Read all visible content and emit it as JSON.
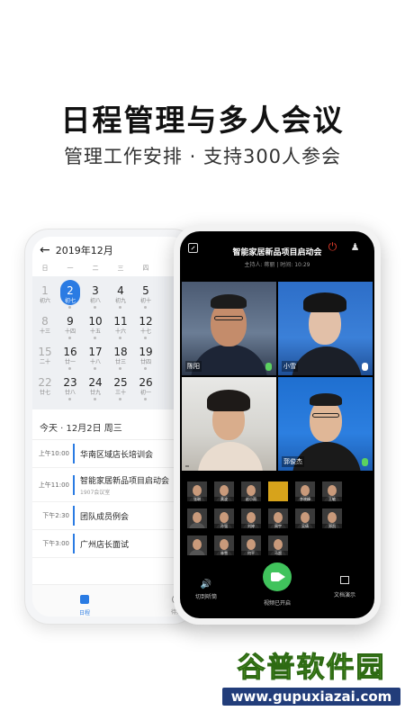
{
  "headline": "日程管理与多人会议",
  "subheadline": "管理工作安排 · 支持300人参会",
  "calendar": {
    "month_label": "2019年12月",
    "weekdays": [
      "日",
      "一",
      "二",
      "三",
      "四"
    ],
    "weeks": [
      [
        {
          "num": "1",
          "lunar": "初六"
        },
        {
          "num": "2",
          "lunar": "初七",
          "selected": true
        },
        {
          "num": "3",
          "lunar": "初八"
        },
        {
          "num": "4",
          "lunar": "初九"
        },
        {
          "num": "5",
          "lunar": "初十"
        }
      ],
      [
        {
          "num": "8",
          "lunar": "十三"
        },
        {
          "num": "9",
          "lunar": "十四"
        },
        {
          "num": "10",
          "lunar": "十五"
        },
        {
          "num": "11",
          "lunar": "十六"
        },
        {
          "num": "12",
          "lunar": "十七"
        }
      ],
      [
        {
          "num": "15",
          "lunar": "二十"
        },
        {
          "num": "16",
          "lunar": "廿一"
        },
        {
          "num": "17",
          "lunar": "十八"
        },
        {
          "num": "18",
          "lunar": "廿三"
        },
        {
          "num": "19",
          "lunar": "廿四"
        }
      ],
      [
        {
          "num": "22",
          "lunar": "廿七"
        },
        {
          "num": "23",
          "lunar": "廿八"
        },
        {
          "num": "24",
          "lunar": "廿九"
        },
        {
          "num": "25",
          "lunar": "三十"
        },
        {
          "num": "26",
          "lunar": "初一"
        }
      ]
    ],
    "today_label": "今天 · 12月2日 周三",
    "events": [
      {
        "time": "上午10:00",
        "title": "华南区域店长培训会",
        "sub": ""
      },
      {
        "time": "上午11:00",
        "title": "智能家居新品项目启动会",
        "sub": "1907会议室"
      },
      {
        "time": "下午2:30",
        "title": "团队成员例会",
        "sub": ""
      },
      {
        "time": "下午3:00",
        "title": "广州店长面试",
        "sub": ""
      }
    ],
    "tab_label": "日程",
    "tab_more_label": "待办"
  },
  "meeting": {
    "title": "智能家居新品项目启动会",
    "subtitle": "主持人: 蒋丽 | 时间: 10:29",
    "participants": [
      {
        "name": "陈阳"
      },
      {
        "name": "小雪"
      },
      {
        "name": ""
      },
      {
        "name": "郭俊杰"
      }
    ],
    "thumb_names": [
      [
        "张琳",
        "黄波",
        "赵小雨",
        "",
        "李晓峰",
        "王敏"
      ],
      [
        "",
        "孙强",
        "刘婷",
        "周宇",
        "吴倩",
        "郑凯"
      ],
      [
        "",
        "林雪",
        "何平",
        "马超",
        "",
        ""
      ]
    ],
    "controls": {
      "speaker_label": "切到听筒",
      "video_label": "视频已开启",
      "doc_label": "文档演示"
    }
  },
  "watermark": {
    "brand": "谷普软件园",
    "url": "www.gupuxiazai.com"
  },
  "colors": {
    "accent": "#2a7be3",
    "green": "#40c35c",
    "end_call": "#e33c2b"
  }
}
